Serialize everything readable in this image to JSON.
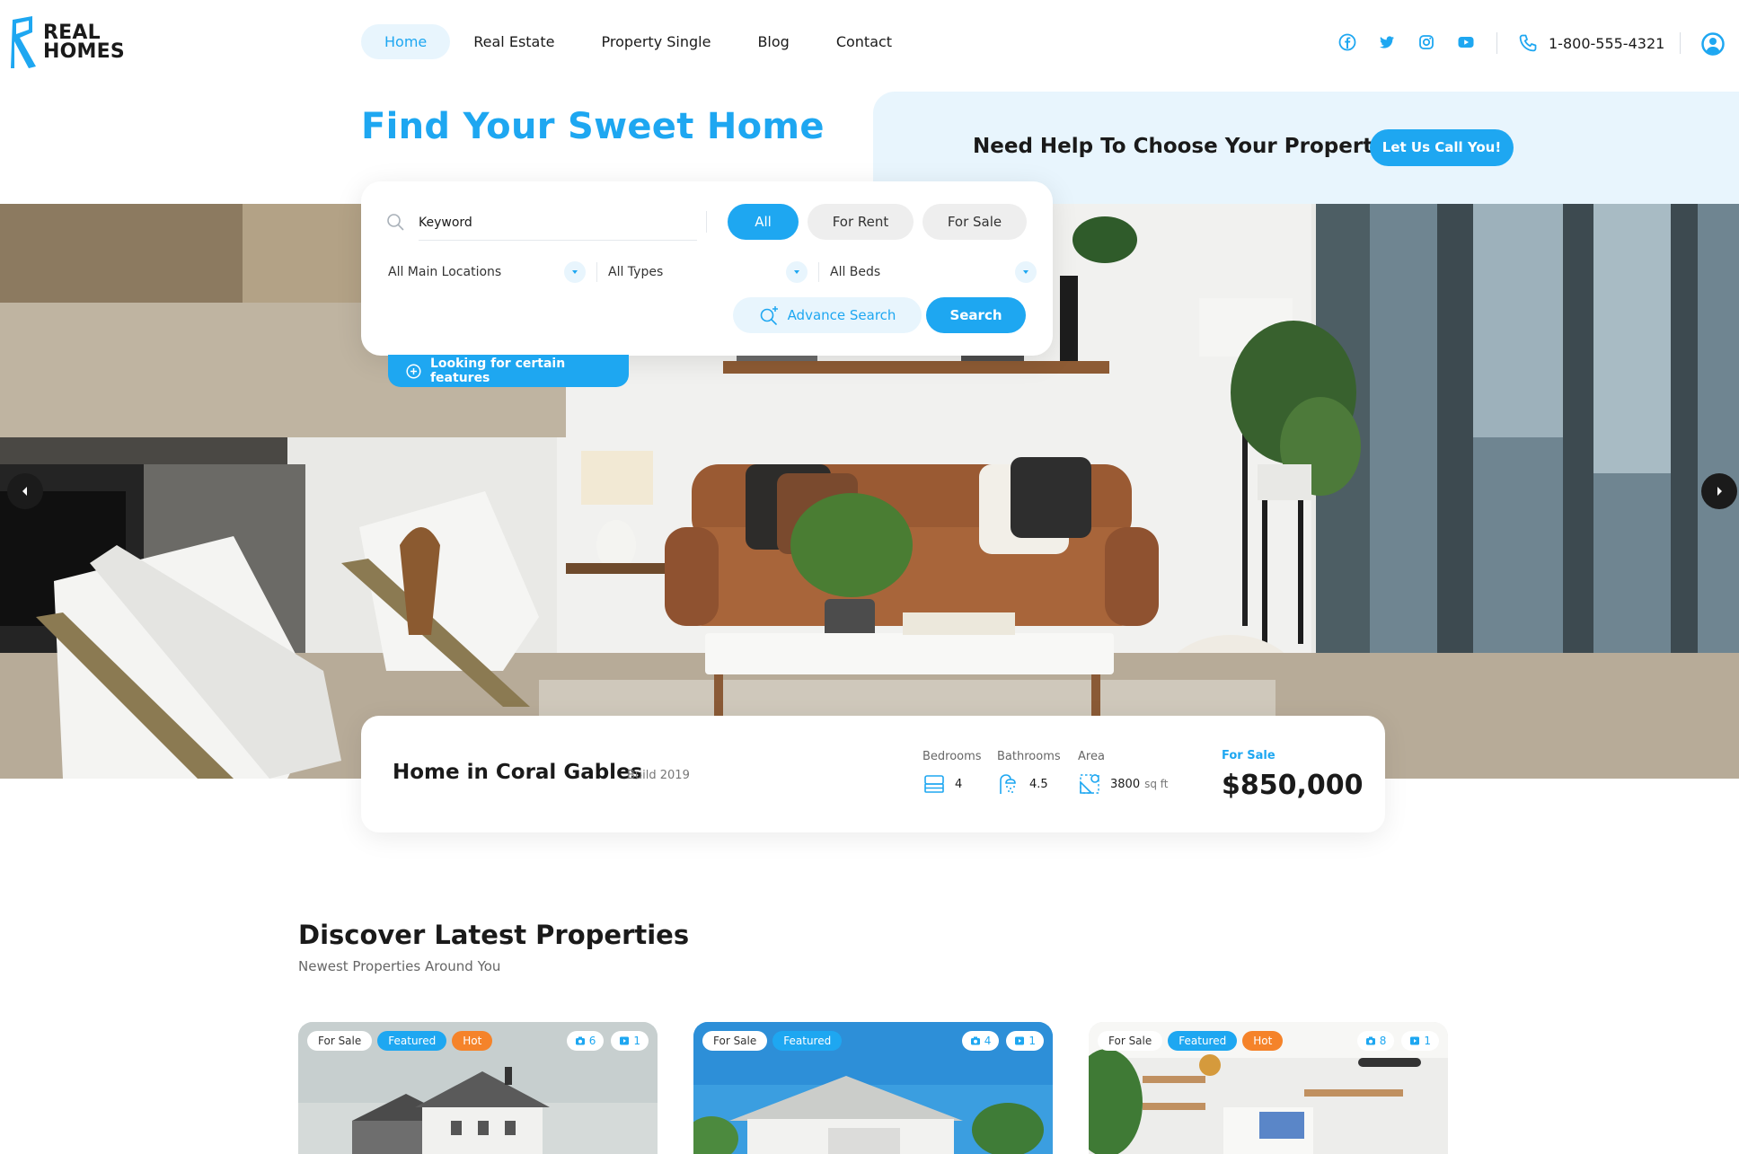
{
  "brand": {
    "line1": "REAL",
    "line2": "HOMES",
    "accent": "#1ea7f1"
  },
  "nav": [
    {
      "label": "Home",
      "active": true
    },
    {
      "label": "Real Estate",
      "active": false
    },
    {
      "label": "Property Single",
      "active": false
    },
    {
      "label": "Blog",
      "active": false
    },
    {
      "label": "Contact",
      "active": false
    }
  ],
  "social_icons": [
    "facebook-icon",
    "twitter-icon",
    "instagram-icon",
    "youtube-icon"
  ],
  "phone": "1-800-555-4321",
  "hero": {
    "title": "Find Your Sweet Home",
    "help_text": "Need Help To Choose Your Property",
    "call_button": "Let Us Call You!"
  },
  "search": {
    "keyword_placeholder": "Keyword",
    "tabs": [
      "All",
      "For Rent",
      "For Sale"
    ],
    "active_tab": "All",
    "selects": [
      "All Main Locations",
      "All Types",
      "All Beds"
    ],
    "advance_label": "Advance Search",
    "search_label": "Search",
    "features_label": "Looking for certain features"
  },
  "featured_property": {
    "title": "Home in Coral Gables",
    "build": "Build 2019",
    "bedrooms_label": "Bedrooms",
    "bedrooms": "4",
    "bathrooms_label": "Bathrooms",
    "bathrooms": "4.5",
    "area_label": "Area",
    "area_value": "3800",
    "area_unit": "sq ft",
    "status": "For Sale",
    "price": "$850,000"
  },
  "latest": {
    "title": "Discover Latest Properties",
    "subtitle": "Newest Properties Around You",
    "cards": [
      {
        "tags": [
          "For Sale",
          "Featured",
          "Hot"
        ],
        "photos": "6",
        "videos": "1"
      },
      {
        "tags": [
          "For Sale",
          "Featured"
        ],
        "photos": "4",
        "videos": "1"
      },
      {
        "tags": [
          "For Sale",
          "Featured",
          "Hot"
        ],
        "photos": "8",
        "videos": "1"
      }
    ]
  }
}
